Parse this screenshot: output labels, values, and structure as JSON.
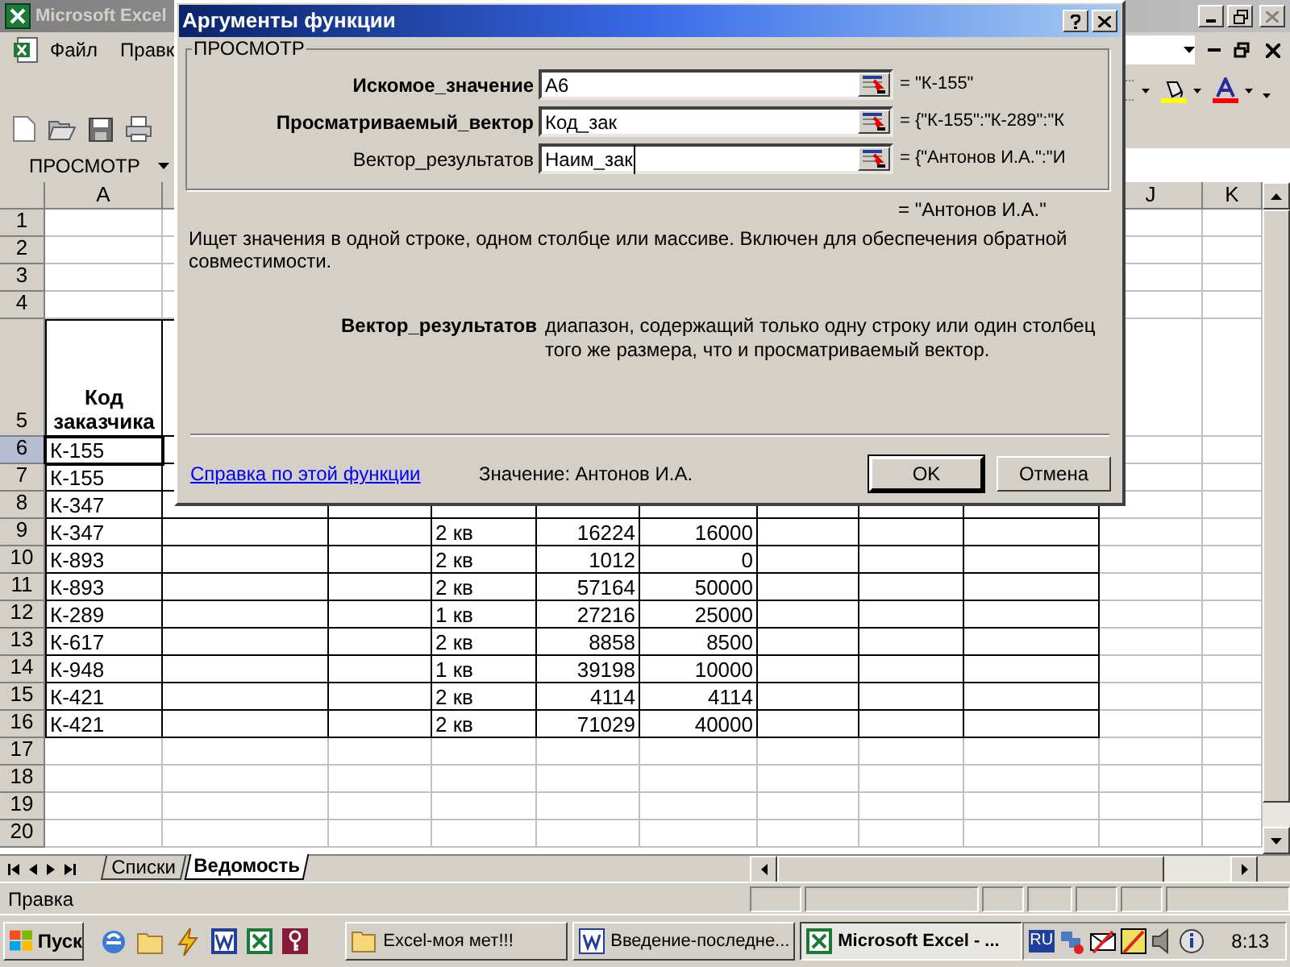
{
  "excel_window": {
    "title": "Microsoft Excel"
  },
  "menu": [
    {
      "label": "Файл"
    },
    {
      "label": "Правк"
    }
  ],
  "name_box": {
    "value": "ПРОСМОТР"
  },
  "sheet": {
    "columns": [
      {
        "header": "A"
      },
      {},
      {},
      {},
      {},
      {},
      {},
      {},
      {},
      {
        "header": "J"
      },
      {
        "header": "K"
      }
    ],
    "rows": [
      {
        "number": "1",
        "kind": "blank",
        "selected": false
      },
      {
        "number": "2",
        "kind": "blank",
        "selected": false
      },
      {
        "number": "3",
        "kind": "blank",
        "selected": false
      },
      {
        "number": "4",
        "kind": "blank",
        "selected": false
      },
      {
        "number": "5",
        "kind": "heading",
        "selected": false,
        "cells": [
          "Код заказчика"
        ]
      },
      {
        "number": "6",
        "kind": "data",
        "selected": true,
        "cells": [
          "К-155"
        ]
      },
      {
        "number": "7",
        "kind": "data",
        "selected": false,
        "cells": [
          "К-155"
        ]
      },
      {
        "number": "8",
        "kind": "data",
        "selected": false,
        "cells": [
          "К-347"
        ]
      },
      {
        "number": "9",
        "kind": "data",
        "selected": false,
        "cells": [
          "К-347",
          null,
          null,
          "2 кв",
          "16224",
          "16000"
        ]
      },
      {
        "number": "10",
        "kind": "data",
        "selected": false,
        "cells": [
          "К-893",
          null,
          null,
          "2 кв",
          "1012",
          "0"
        ]
      },
      {
        "number": "11",
        "kind": "data",
        "selected": false,
        "cells": [
          "К-893",
          null,
          null,
          "2 кв",
          "57164",
          "50000"
        ]
      },
      {
        "number": "12",
        "kind": "data",
        "selected": false,
        "cells": [
          "К-289",
          null,
          null,
          "1 кв",
          "27216",
          "25000"
        ]
      },
      {
        "number": "13",
        "kind": "data",
        "selected": false,
        "cells": [
          "К-617",
          null,
          null,
          "2 кв",
          "8858",
          "8500"
        ]
      },
      {
        "number": "14",
        "kind": "data",
        "selected": false,
        "cells": [
          "К-948",
          null,
          null,
          "1 кв",
          "39198",
          "10000"
        ]
      },
      {
        "number": "15",
        "kind": "data",
        "selected": false,
        "cells": [
          "К-421",
          null,
          null,
          "2 кв",
          "4114",
          "4114"
        ]
      },
      {
        "number": "16",
        "kind": "data",
        "selected": false,
        "cells": [
          "К-421",
          null,
          null,
          "2 кв",
          "71029",
          "40000"
        ]
      },
      {
        "number": "17",
        "kind": "blank",
        "selected": false
      },
      {
        "number": "18",
        "kind": "blank",
        "selected": false
      },
      {
        "number": "19",
        "kind": "blank",
        "selected": false
      },
      {
        "number": "20",
        "kind": "blank",
        "selected": false
      }
    ]
  },
  "sheet_tabs": [
    {
      "label": "Списки",
      "selected": false
    },
    {
      "label": "Ведомость",
      "selected": true
    }
  ],
  "status_bar": {
    "text": "Правка"
  },
  "dialog": {
    "title": "Аргументы функции",
    "group": "ПРОСМОТР",
    "arguments": [
      {
        "label": "Искомое_значение",
        "value": "A6",
        "result": "= \"К-155\"",
        "required": true,
        "focused": false
      },
      {
        "label": "Просматриваемый_вектор",
        "value": "Код_зак",
        "result": "= {\"К-155\":\"К-289\":\"К",
        "required": true,
        "focused": false
      },
      {
        "label": "Вектор_результатов",
        "value": "Наим_зак",
        "result": "= {\"Антонов И.А.\":\"И",
        "required": false,
        "focused": true
      }
    ],
    "result": "= \"Антонов И.А.\"",
    "description": "Ищет значения в одной строке, одном столбце или массиве. Включен для обеспечения обратной совместимости.",
    "argument_help": {
      "label": "Вектор_результатов",
      "text": "диапазон, содержащий только одну строку или один столбец того же размера, что и просматриваемый вектор."
    },
    "help_link": "Справка по этой функции",
    "value_label": "Значение:",
    "value": "Антонов И.А.",
    "buttons": [
      {
        "label": "OK",
        "default": true
      },
      {
        "label": "Отмена",
        "default": false
      }
    ]
  },
  "taskbar": {
    "start": "Пуск",
    "tasks": [
      {
        "label": "Excel-моя мет!!!",
        "kind": "folder",
        "selected": false
      },
      {
        "label": "Введение-последне...",
        "kind": "word",
        "selected": false
      },
      {
        "label": "Microsoft Excel - ...",
        "kind": "excel",
        "selected": true
      }
    ],
    "language": "RU",
    "clock": "8:13"
  }
}
